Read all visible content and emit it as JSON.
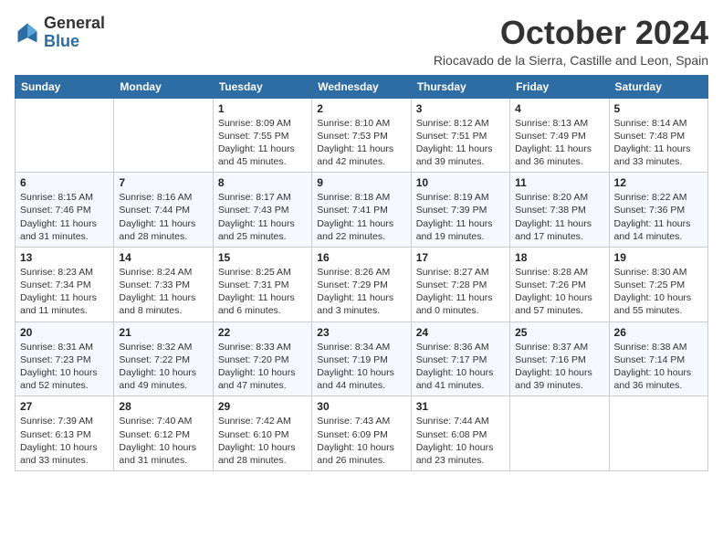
{
  "logo": {
    "general": "General",
    "blue": "Blue"
  },
  "header": {
    "title": "October 2024",
    "subtitle": "Riocavado de la Sierra, Castille and Leon, Spain"
  },
  "columns": [
    "Sunday",
    "Monday",
    "Tuesday",
    "Wednesday",
    "Thursday",
    "Friday",
    "Saturday"
  ],
  "weeks": [
    [
      {
        "day": "",
        "info": ""
      },
      {
        "day": "",
        "info": ""
      },
      {
        "day": "1",
        "info": "Sunrise: 8:09 AM\nSunset: 7:55 PM\nDaylight: 11 hours and 45 minutes."
      },
      {
        "day": "2",
        "info": "Sunrise: 8:10 AM\nSunset: 7:53 PM\nDaylight: 11 hours and 42 minutes."
      },
      {
        "day": "3",
        "info": "Sunrise: 8:12 AM\nSunset: 7:51 PM\nDaylight: 11 hours and 39 minutes."
      },
      {
        "day": "4",
        "info": "Sunrise: 8:13 AM\nSunset: 7:49 PM\nDaylight: 11 hours and 36 minutes."
      },
      {
        "day": "5",
        "info": "Sunrise: 8:14 AM\nSunset: 7:48 PM\nDaylight: 11 hours and 33 minutes."
      }
    ],
    [
      {
        "day": "6",
        "info": "Sunrise: 8:15 AM\nSunset: 7:46 PM\nDaylight: 11 hours and 31 minutes."
      },
      {
        "day": "7",
        "info": "Sunrise: 8:16 AM\nSunset: 7:44 PM\nDaylight: 11 hours and 28 minutes."
      },
      {
        "day": "8",
        "info": "Sunrise: 8:17 AM\nSunset: 7:43 PM\nDaylight: 11 hours and 25 minutes."
      },
      {
        "day": "9",
        "info": "Sunrise: 8:18 AM\nSunset: 7:41 PM\nDaylight: 11 hours and 22 minutes."
      },
      {
        "day": "10",
        "info": "Sunrise: 8:19 AM\nSunset: 7:39 PM\nDaylight: 11 hours and 19 minutes."
      },
      {
        "day": "11",
        "info": "Sunrise: 8:20 AM\nSunset: 7:38 PM\nDaylight: 11 hours and 17 minutes."
      },
      {
        "day": "12",
        "info": "Sunrise: 8:22 AM\nSunset: 7:36 PM\nDaylight: 11 hours and 14 minutes."
      }
    ],
    [
      {
        "day": "13",
        "info": "Sunrise: 8:23 AM\nSunset: 7:34 PM\nDaylight: 11 hours and 11 minutes."
      },
      {
        "day": "14",
        "info": "Sunrise: 8:24 AM\nSunset: 7:33 PM\nDaylight: 11 hours and 8 minutes."
      },
      {
        "day": "15",
        "info": "Sunrise: 8:25 AM\nSunset: 7:31 PM\nDaylight: 11 hours and 6 minutes."
      },
      {
        "day": "16",
        "info": "Sunrise: 8:26 AM\nSunset: 7:29 PM\nDaylight: 11 hours and 3 minutes."
      },
      {
        "day": "17",
        "info": "Sunrise: 8:27 AM\nSunset: 7:28 PM\nDaylight: 11 hours and 0 minutes."
      },
      {
        "day": "18",
        "info": "Sunrise: 8:28 AM\nSunset: 7:26 PM\nDaylight: 10 hours and 57 minutes."
      },
      {
        "day": "19",
        "info": "Sunrise: 8:30 AM\nSunset: 7:25 PM\nDaylight: 10 hours and 55 minutes."
      }
    ],
    [
      {
        "day": "20",
        "info": "Sunrise: 8:31 AM\nSunset: 7:23 PM\nDaylight: 10 hours and 52 minutes."
      },
      {
        "day": "21",
        "info": "Sunrise: 8:32 AM\nSunset: 7:22 PM\nDaylight: 10 hours and 49 minutes."
      },
      {
        "day": "22",
        "info": "Sunrise: 8:33 AM\nSunset: 7:20 PM\nDaylight: 10 hours and 47 minutes."
      },
      {
        "day": "23",
        "info": "Sunrise: 8:34 AM\nSunset: 7:19 PM\nDaylight: 10 hours and 44 minutes."
      },
      {
        "day": "24",
        "info": "Sunrise: 8:36 AM\nSunset: 7:17 PM\nDaylight: 10 hours and 41 minutes."
      },
      {
        "day": "25",
        "info": "Sunrise: 8:37 AM\nSunset: 7:16 PM\nDaylight: 10 hours and 39 minutes."
      },
      {
        "day": "26",
        "info": "Sunrise: 8:38 AM\nSunset: 7:14 PM\nDaylight: 10 hours and 36 minutes."
      }
    ],
    [
      {
        "day": "27",
        "info": "Sunrise: 7:39 AM\nSunset: 6:13 PM\nDaylight: 10 hours and 33 minutes."
      },
      {
        "day": "28",
        "info": "Sunrise: 7:40 AM\nSunset: 6:12 PM\nDaylight: 10 hours and 31 minutes."
      },
      {
        "day": "29",
        "info": "Sunrise: 7:42 AM\nSunset: 6:10 PM\nDaylight: 10 hours and 28 minutes."
      },
      {
        "day": "30",
        "info": "Sunrise: 7:43 AM\nSunset: 6:09 PM\nDaylight: 10 hours and 26 minutes."
      },
      {
        "day": "31",
        "info": "Sunrise: 7:44 AM\nSunset: 6:08 PM\nDaylight: 10 hours and 23 minutes."
      },
      {
        "day": "",
        "info": ""
      },
      {
        "day": "",
        "info": ""
      }
    ]
  ]
}
